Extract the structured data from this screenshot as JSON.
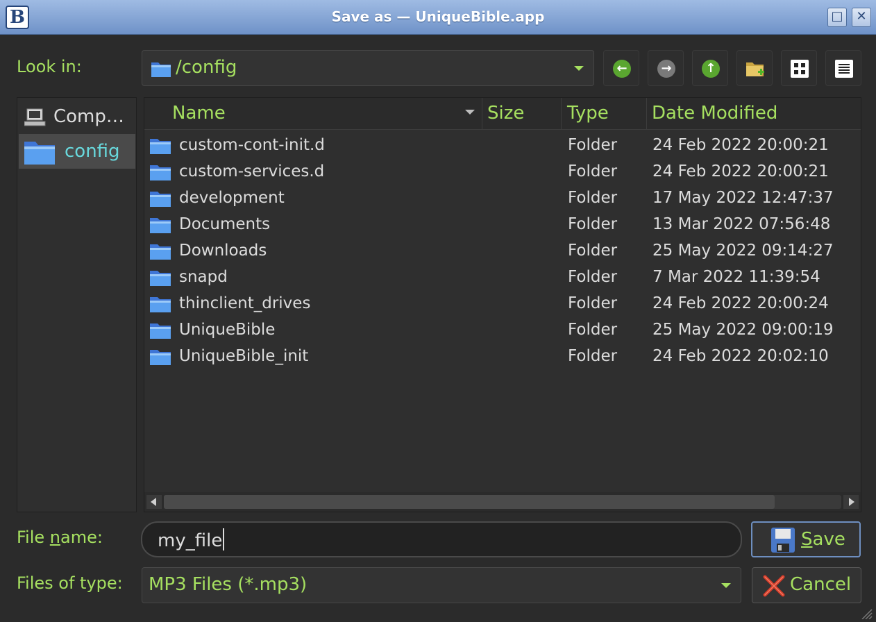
{
  "window": {
    "title": "Save as — UniqueBible.app",
    "app_icon_letter": "B",
    "maximize_label": "□",
    "close_label": "✕"
  },
  "look_in": {
    "label": "Look in:",
    "value": "/config"
  },
  "nav": [
    "back-icon",
    "forward-icon",
    "up-icon",
    "new-folder-icon",
    "icon-view-icon",
    "detail-view-icon"
  ],
  "sidebar": {
    "items": [
      {
        "label": "Comp…",
        "icon": "computer-icon"
      },
      {
        "label": "config",
        "icon": "folder-icon",
        "selected": true
      }
    ]
  },
  "columns": {
    "name": "Name",
    "size": "Size",
    "type": "Type",
    "date": "Date Modified"
  },
  "files": [
    {
      "name": "custom-cont-init.d",
      "size": "",
      "type": "Folder",
      "date": "24 Feb 2022 20:00:21"
    },
    {
      "name": "custom-services.d",
      "size": "",
      "type": "Folder",
      "date": "24 Feb 2022 20:00:21"
    },
    {
      "name": "development",
      "size": "",
      "type": "Folder",
      "date": "17 May 2022 12:47:37"
    },
    {
      "name": "Documents",
      "size": "",
      "type": "Folder",
      "date": "13 Mar 2022 07:56:48"
    },
    {
      "name": "Downloads",
      "size": "",
      "type": "Folder",
      "date": "25 May 2022 09:14:27"
    },
    {
      "name": "snapd",
      "size": "",
      "type": "Folder",
      "date": "7 Mar 2022 11:39:54"
    },
    {
      "name": "thinclient_drives",
      "size": "",
      "type": "Folder",
      "date": "24 Feb 2022 20:00:24"
    },
    {
      "name": "UniqueBible",
      "size": "",
      "type": "Folder",
      "date": "25 May 2022 09:00:19"
    },
    {
      "name": "UniqueBible_init",
      "size": "",
      "type": "Folder",
      "date": "24 Feb 2022 20:02:10"
    }
  ],
  "file_name": {
    "label_pre": "File ",
    "label_mnemonic": "n",
    "label_post": "ame:",
    "value": "my_file"
  },
  "file_type": {
    "label": "Files of type:",
    "value": "MP3 Files (*.mp3)"
  },
  "buttons": {
    "save_mnemonic": "S",
    "save_rest": "ave",
    "cancel": "Cancel"
  },
  "colors": {
    "accent_green": "#a6e060",
    "selection_cyan": "#68d8dc",
    "titlebar_blue": "#7f9fd2"
  }
}
